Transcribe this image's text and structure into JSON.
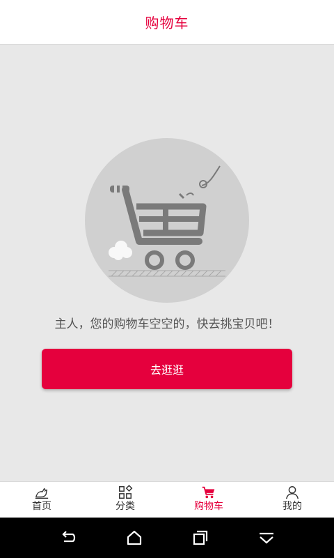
{
  "header": {
    "title": "购物车"
  },
  "empty_state": {
    "illustration_icon": "empty-cart-illustration",
    "message": "主人，您的购物车空空的，快去挑宝贝吧！",
    "button_label": "去逛逛"
  },
  "tabbar": {
    "tabs": [
      {
        "label": "首页",
        "icon": "home-icon",
        "active": false
      },
      {
        "label": "分类",
        "icon": "category-icon",
        "active": false
      },
      {
        "label": "购物车",
        "icon": "cart-icon",
        "active": true
      },
      {
        "label": "我的",
        "icon": "user-icon",
        "active": false
      }
    ]
  },
  "system_nav": {
    "buttons": [
      "back-icon",
      "home-icon",
      "recents-icon",
      "hide-keyboard-icon"
    ]
  },
  "colors": {
    "accent": "#e5003d",
    "background": "#e8e8e8",
    "text": "#555555"
  }
}
